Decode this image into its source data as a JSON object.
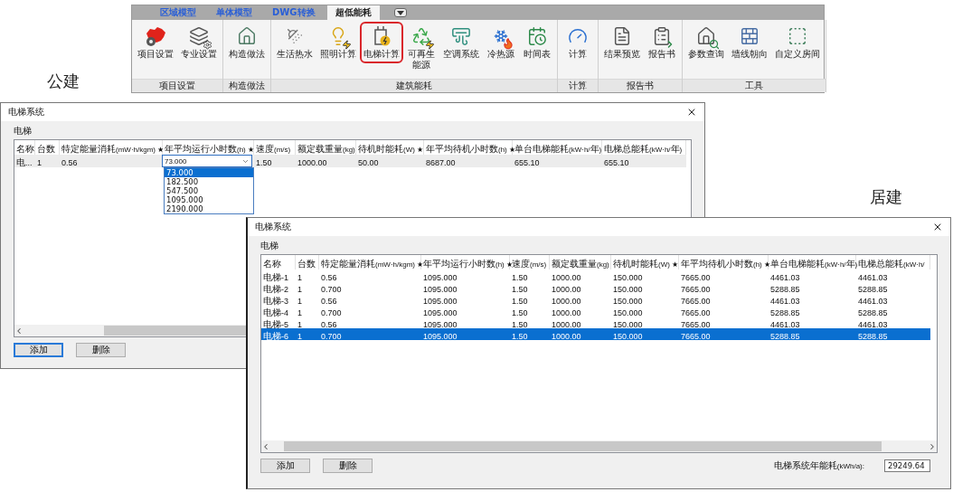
{
  "ribbon": {
    "tabs": [
      {
        "label": "区域模型",
        "selected": false
      },
      {
        "label": "单体模型",
        "selected": false
      },
      {
        "label": "DWG转换",
        "selected": false
      },
      {
        "label": "超低能耗",
        "selected": true
      }
    ],
    "groups": [
      {
        "label": "项目设置",
        "items": [
          {
            "label": "项目设置",
            "highlighted": false
          },
          {
            "label": "专业设置",
            "highlighted": false
          }
        ]
      },
      {
        "label": "构造做法",
        "items": [
          {
            "label": "构造做法",
            "highlighted": false
          }
        ]
      },
      {
        "label": "建筑能耗",
        "items": [
          {
            "label": "生活热水",
            "highlighted": false
          },
          {
            "label": "照明计算",
            "highlighted": false
          },
          {
            "label": "电梯计算",
            "highlighted": true
          },
          {
            "label": "可再生能源",
            "highlighted": false
          },
          {
            "label": "空调系统",
            "highlighted": false
          },
          {
            "label": "冷热源",
            "highlighted": false
          },
          {
            "label": "时间表",
            "highlighted": false
          }
        ]
      },
      {
        "label": "计算",
        "items": [
          {
            "label": "计算",
            "highlighted": false
          }
        ]
      },
      {
        "label": "报告书",
        "items": [
          {
            "label": "结果预览",
            "highlighted": false
          },
          {
            "label": "报告书",
            "highlighted": false
          }
        ]
      },
      {
        "label": "工具",
        "items": [
          {
            "label": "参数查询",
            "highlighted": false
          },
          {
            "label": "墙线朝向",
            "highlighted": false
          },
          {
            "label": "自定义房间",
            "highlighted": false
          }
        ]
      }
    ]
  },
  "left_caption": "公建",
  "right_caption": "居建",
  "dialogs": [
    {
      "title": "电梯系统",
      "focused": false,
      "group_label": "电梯",
      "columns": [
        "名称",
        "台数",
        "特定能量消耗(mW·h/kgm) ★",
        "年平均运行小时数(h) ★",
        "速度(m/s)",
        "额定载重量(kg)",
        "待机时能耗(W) ★",
        "年平均待机小时数(h) ★",
        "单台电梯能耗(kW·h/年)",
        "电梯总能耗(kW·h/年)"
      ],
      "rows": [
        {
          "selected": true,
          "cells": [
            "电...",
            "1",
            "0.56",
            {
              "kind": "dropdown",
              "value": "73.000",
              "options": [
                {
                  "label": "73.000",
                  "selected": true
                },
                {
                  "label": "182.500",
                  "selected": false
                },
                {
                  "label": "547.500",
                  "selected": false
                },
                {
                  "label": "1095.000",
                  "selected": false
                },
                {
                  "label": "2190.000",
                  "selected": false
                }
              ]
            },
            "1.50",
            "1000.00",
            "50.00",
            "8687.00",
            "655.10",
            "655.10"
          ]
        }
      ],
      "buttons": [
        {
          "label": "添加",
          "focused": true
        },
        {
          "label": "删除",
          "focused": false
        }
      ]
    },
    {
      "title": "电梯系统",
      "focused": true,
      "group_label": "电梯",
      "columns": [
        "名称",
        "台数",
        "特定能量消耗(mW·h/kgm) ★",
        "年平均运行小时数(h) ★",
        "速度(m/s)",
        "额定载重量(kg)",
        "待机时能耗(W) ★",
        "年平均待机小时数(h) ★",
        "单台电梯能耗(kW·h/年)",
        "电梯总能耗(kW·h/"
      ],
      "rows": [
        {
          "selected": false,
          "cells": [
            "电梯-1",
            "1",
            "0.56",
            "1095.000",
            "1.50",
            "1000.00",
            "150.000",
            "7665.00",
            "4461.03",
            "4461.03"
          ]
        },
        {
          "selected": false,
          "cells": [
            "电梯-2",
            "1",
            "0.700",
            "1095.000",
            "1.50",
            "1000.00",
            "150.000",
            "7665.00",
            "5288.85",
            "5288.85"
          ]
        },
        {
          "selected": false,
          "cells": [
            "电梯-3",
            "1",
            "0.56",
            "1095.000",
            "1.50",
            "1000.00",
            "150.000",
            "7665.00",
            "4461.03",
            "4461.03"
          ]
        },
        {
          "selected": false,
          "cells": [
            "电梯-4",
            "1",
            "0.700",
            "1095.000",
            "1.50",
            "1000.00",
            "150.000",
            "7665.00",
            "5288.85",
            "5288.85"
          ]
        },
        {
          "selected": false,
          "cells": [
            "电梯-5",
            "1",
            "0.56",
            "1095.000",
            "1.50",
            "1000.00",
            "150.000",
            "7665.00",
            "4461.03",
            "4461.03"
          ]
        },
        {
          "selected": true,
          "cells": [
            "电梯-6",
            "1",
            "0.700",
            "1095.000",
            "1.50",
            "1000.00",
            "150.000",
            "7665.00",
            "5288.85",
            "5288.85"
          ]
        }
      ],
      "buttons": [
        {
          "label": "添加",
          "focused": false
        },
        {
          "label": "删除",
          "focused": false
        }
      ],
      "total": {
        "label": "电梯系统年能耗(kWh/a):",
        "value": "29249.64"
      }
    }
  ]
}
